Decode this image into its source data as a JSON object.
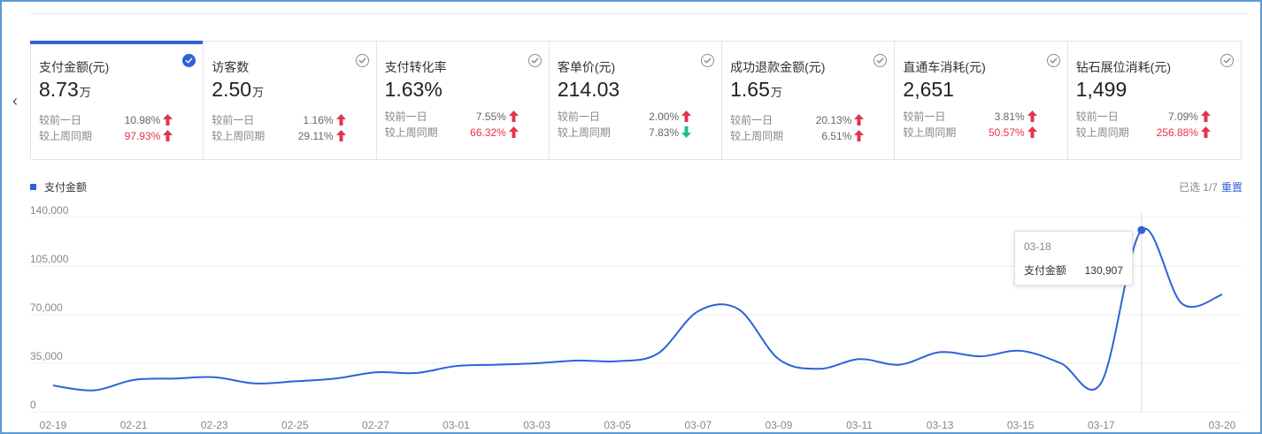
{
  "nav": {
    "prev_icon": "‹"
  },
  "cards": [
    {
      "title": "支付金额(元)",
      "value": "8.73",
      "unit": "万",
      "selected": true,
      "compare": [
        {
          "label": "较前一日",
          "value": "10.98%",
          "dir": "up",
          "highlight": false
        },
        {
          "label": "较上周同期",
          "value": "97.93%",
          "dir": "up",
          "highlight": true
        }
      ]
    },
    {
      "title": "访客数",
      "value": "2.50",
      "unit": "万",
      "selected": false,
      "compare": [
        {
          "label": "较前一日",
          "value": "1.16%",
          "dir": "up",
          "highlight": false
        },
        {
          "label": "较上周同期",
          "value": "29.11%",
          "dir": "up",
          "highlight": false
        }
      ]
    },
    {
      "title": "支付转化率",
      "value": "1.63%",
      "unit": "",
      "selected": false,
      "compare": [
        {
          "label": "较前一日",
          "value": "7.55%",
          "dir": "up",
          "highlight": false
        },
        {
          "label": "较上周同期",
          "value": "66.32%",
          "dir": "up",
          "highlight": true
        }
      ]
    },
    {
      "title": "客单价(元)",
      "value": "214.03",
      "unit": "",
      "selected": false,
      "compare": [
        {
          "label": "较前一日",
          "value": "2.00%",
          "dir": "up",
          "highlight": false
        },
        {
          "label": "较上周同期",
          "value": "7.83%",
          "dir": "down",
          "highlight": false
        }
      ]
    },
    {
      "title": "成功退款金额(元)",
      "value": "1.65",
      "unit": "万",
      "selected": false,
      "compare": [
        {
          "label": "较前一日",
          "value": "20.13%",
          "dir": "up",
          "highlight": false
        },
        {
          "label": "较上周同期",
          "value": "6.51%",
          "dir": "up",
          "highlight": false
        }
      ]
    },
    {
      "title": "直通车消耗(元)",
      "value": "2,651",
      "unit": "",
      "selected": false,
      "compare": [
        {
          "label": "较前一日",
          "value": "3.81%",
          "dir": "up",
          "highlight": false
        },
        {
          "label": "较上周同期",
          "value": "50.57%",
          "dir": "up",
          "highlight": true
        }
      ]
    },
    {
      "title": "钻石展位消耗(元)",
      "value": "1,499",
      "unit": "",
      "selected": false,
      "compare": [
        {
          "label": "较前一日",
          "value": "7.09%",
          "dir": "up",
          "highlight": false
        },
        {
          "label": "较上周同期",
          "value": "256.88%",
          "dir": "up",
          "highlight": true
        }
      ]
    }
  ],
  "colors": {
    "accent": "#2d63d9",
    "up": "#e53250",
    "down": "#1fbf8f",
    "line": "#2d63d9"
  },
  "chart_meta": {
    "selected_count": "已选 1/7",
    "reset_label": "重置"
  },
  "tooltip": {
    "date": "03-18",
    "label": "支付金额",
    "value": "130,907"
  },
  "chart_data": {
    "type": "line",
    "title": "",
    "xlabel": "",
    "ylabel": "",
    "x": [
      "02-19",
      "02-20",
      "02-21",
      "02-22",
      "02-23",
      "02-24",
      "02-25",
      "02-26",
      "02-27",
      "02-28",
      "03-01",
      "03-02",
      "03-03",
      "03-04",
      "03-05",
      "03-06",
      "03-07",
      "03-08",
      "03-09",
      "03-10",
      "03-11",
      "03-12",
      "03-13",
      "03-14",
      "03-15",
      "03-16",
      "03-17",
      "03-18",
      "03-19",
      "03-20"
    ],
    "x_tick_labels": [
      "02-19",
      "02-21",
      "02-23",
      "02-25",
      "02-27",
      "03-01",
      "03-03",
      "03-05",
      "03-07",
      "03-09",
      "03-11",
      "03-13",
      "03-15",
      "03-17",
      "03-20"
    ],
    "y_ticks": [
      "0",
      "35,000",
      "70,000",
      "105,000",
      "140,000"
    ],
    "ylim": [
      0,
      140000
    ],
    "grid": true,
    "legend": "top-left",
    "series": [
      {
        "name": "支付金额",
        "values": [
          19000,
          15500,
          23000,
          24000,
          25000,
          20500,
          22000,
          24000,
          28500,
          28000,
          33000,
          34000,
          35000,
          37000,
          36500,
          42000,
          72500,
          74000,
          38000,
          31000,
          38000,
          34000,
          43000,
          40000,
          44000,
          35000,
          21000,
          130907,
          78000,
          84500
        ]
      }
    ],
    "highlight": {
      "x": "03-18",
      "value": 130907
    }
  }
}
